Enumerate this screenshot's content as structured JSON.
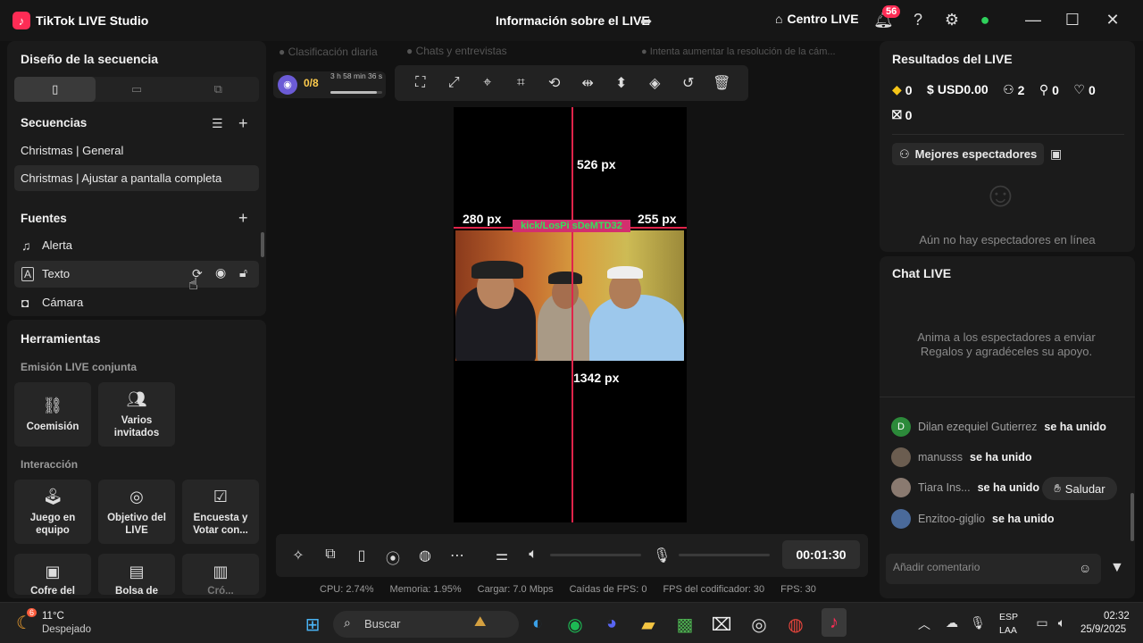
{
  "titlebar": {
    "app_title": "TikTok LIVE Studio",
    "live_info": "Información sobre el LIVE",
    "centro_live": "Centro LIVE",
    "notification_count": "56",
    "icons": [
      "tiktok-logo-icon",
      "share-icon",
      "home-icon",
      "bell-icon",
      "help-icon",
      "settings-icon",
      "network-icon",
      "minimize-icon",
      "maximize-icon",
      "close-icon"
    ]
  },
  "left": {
    "design_title": "Diseño de la secuencia",
    "layout_tabs": [
      "portrait",
      "landscape",
      "dual"
    ],
    "sequences_title": "Secuencias",
    "sequences": [
      "Christmas | General",
      "Christmas | Ajustar a pantalla completa"
    ],
    "sources_title": "Fuentes",
    "sources": [
      "Alerta",
      "Texto",
      "Cámara"
    ],
    "tools_title": "Herramientas",
    "joint_live_title": "Emisión LIVE conjunta",
    "joint_tools": [
      "Coemisión",
      "Varios invitados"
    ],
    "interaction_title": "Interacción",
    "interaction_tools": [
      "Juego en equipo",
      "Objetivo del LIVE",
      "Encuesta y Votar con...",
      "Cofre del",
      "Bolsa de",
      "Cró..."
    ]
  },
  "center": {
    "tabs_faded": [
      "Clasificación diaria",
      "Chats y entrevistas",
      "Intenta aumentar la resolución de la cám..."
    ],
    "progress_count": "0/8",
    "progress_time": "3 h 58 min 36 s",
    "progress_fraction": 0.9,
    "overlay_labels": {
      "top": "526 px",
      "left": "280 px",
      "right": "255 px",
      "bottom": "1342 px"
    },
    "kick_banner": "kick/LosPi   sDeMTD32",
    "timer": "00:01:30",
    "status": {
      "cpu": "CPU: 2.74%",
      "memory": "Memoria: 1.95%",
      "upload": "Cargar: 7.0 Mbps",
      "fps_drops": "Caídas de FPS: 0",
      "encoder_fps": "FPS del codificador: 30",
      "fps": "FPS: 30"
    }
  },
  "right": {
    "results_title": "Resultados del LIVE",
    "stats": {
      "diamonds": "0",
      "usd": "USD0.00",
      "viewers": "2",
      "new_followers": "0",
      "likes": "0",
      "gifts": "0"
    },
    "top_viewers_btn": "Mejores espectadores",
    "no_viewers": "Aún no hay espectadores en línea",
    "chat_title": "Chat LIVE",
    "chat_empty": "Anima a los espectadores a enviar Regalos y agradéceles su apoyo.",
    "joined_text": "se ha unido",
    "chat_users": [
      {
        "initial": "D",
        "name": "Dilan ezequiel Gutierrez"
      },
      {
        "initial": "",
        "name": "manusss"
      },
      {
        "initial": "",
        "name": "Tiara Ins..."
      },
      {
        "initial": "",
        "name": "Enzitoo-giglio"
      }
    ],
    "saludar": "Saludar",
    "comment_placeholder": "Añadir comentario"
  },
  "taskbar": {
    "weather_temp": "11°C",
    "weather_desc": "Despejado",
    "weather_badge": "6",
    "search_label": "Buscar",
    "lang_top": "ESP",
    "lang_bottom": "LAA",
    "time": "02:32",
    "date": "25/9/2025"
  },
  "colors": {
    "accent": "#fe2c55",
    "guide_line": "#e0244a",
    "panel": "#1b1b1b",
    "background": "#121212"
  }
}
